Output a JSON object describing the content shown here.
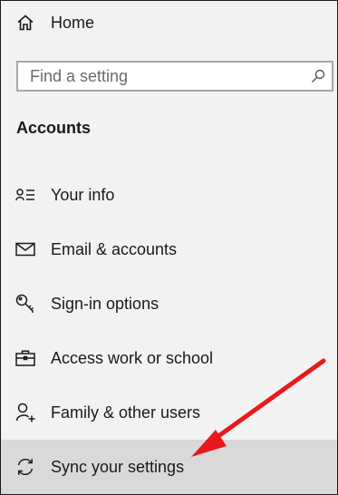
{
  "nav": {
    "home_label": "Home",
    "search_placeholder": "Find a setting",
    "section_title": "Accounts",
    "items": [
      {
        "label": "Your info",
        "icon": "person-card-icon"
      },
      {
        "label": "Email & accounts",
        "icon": "envelope-icon"
      },
      {
        "label": "Sign-in options",
        "icon": "key-icon"
      },
      {
        "label": "Access work or school",
        "icon": "briefcase-icon"
      },
      {
        "label": "Family & other users",
        "icon": "add-person-icon"
      },
      {
        "label": "Sync your settings",
        "icon": "sync-icon",
        "selected": true
      }
    ]
  },
  "colors": {
    "background": "#f2f2f2",
    "selected_background": "#d9d9d9",
    "annotation_arrow": "#e8191d"
  }
}
